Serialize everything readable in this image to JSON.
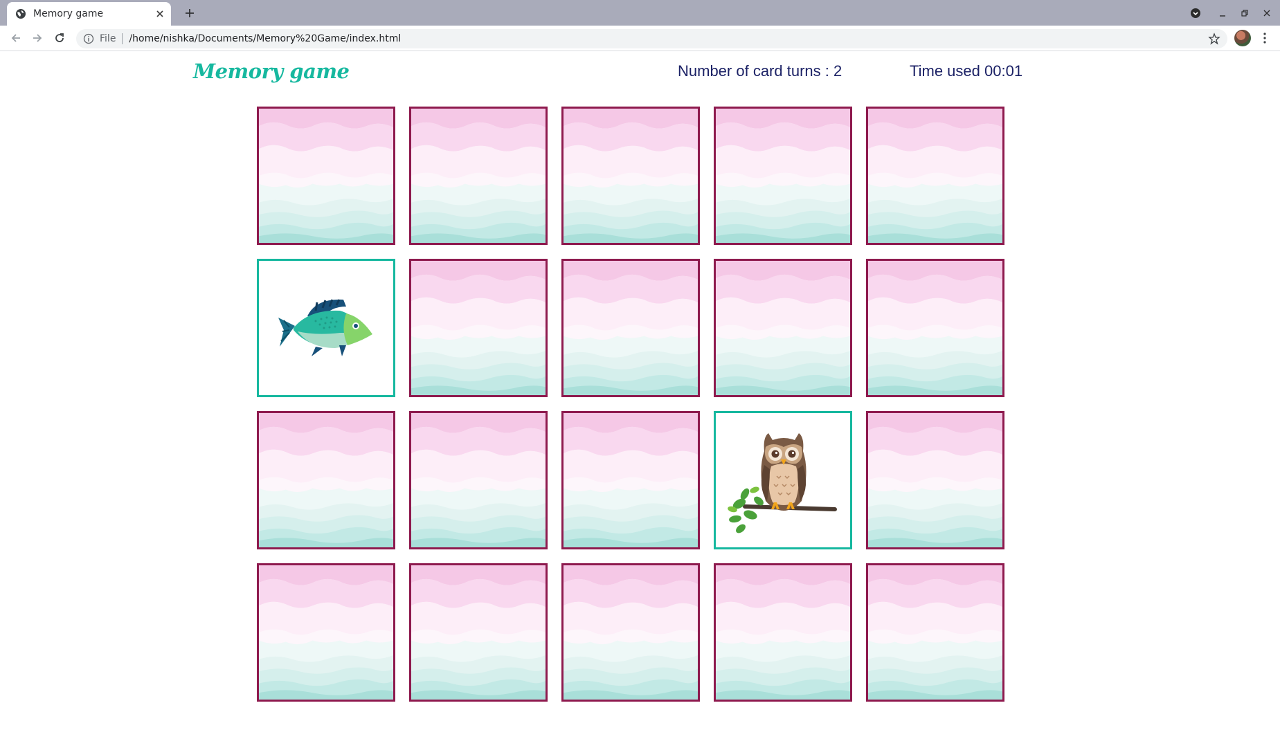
{
  "browser": {
    "tab_title": "Memory game",
    "omnibox_scheme": "File",
    "omnibox_url": "/home/nishka/Documents/Memory%20Game/index.html",
    "icons": [
      "globe-icon",
      "close-icon",
      "plus-icon",
      "back-arrow-icon",
      "forward-arrow-icon",
      "reload-icon",
      "info-icon",
      "star-icon",
      "kebab-menu-icon",
      "tab-search-icon",
      "minimize-icon",
      "restore-icon",
      "window-close-icon"
    ]
  },
  "header": {
    "title": "Memory game",
    "turns_label": "Number of card turns : 2",
    "timer_label": "Time used 00:01"
  },
  "colors": {
    "accent": "#16b89f",
    "card_border": "#8e1a4e",
    "text": "#1c2266"
  },
  "board": {
    "rows": 4,
    "columns": 5,
    "cards": [
      {
        "state": "hidden"
      },
      {
        "state": "hidden"
      },
      {
        "state": "hidden"
      },
      {
        "state": "hidden"
      },
      {
        "state": "hidden"
      },
      {
        "state": "revealed",
        "image": "fish"
      },
      {
        "state": "hidden"
      },
      {
        "state": "hidden"
      },
      {
        "state": "hidden"
      },
      {
        "state": "hidden"
      },
      {
        "state": "hidden"
      },
      {
        "state": "hidden"
      },
      {
        "state": "hidden"
      },
      {
        "state": "revealed",
        "image": "owl"
      },
      {
        "state": "hidden"
      },
      {
        "state": "hidden"
      },
      {
        "state": "hidden"
      },
      {
        "state": "hidden"
      },
      {
        "state": "hidden"
      },
      {
        "state": "hidden"
      }
    ]
  }
}
